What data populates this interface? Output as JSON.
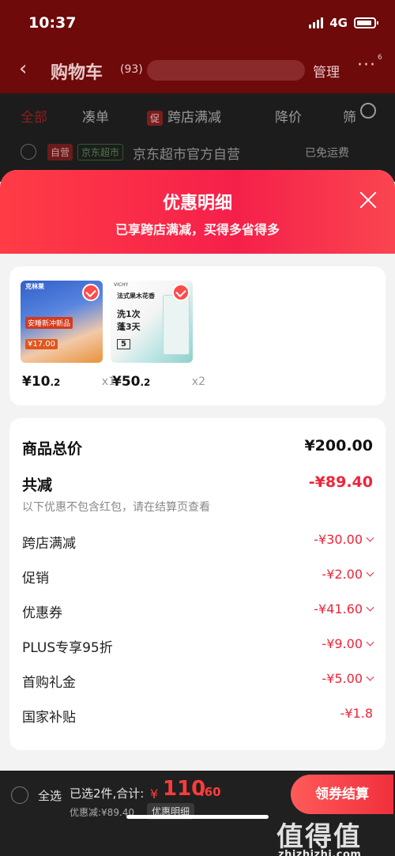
{
  "status_bar": {
    "time": "10:37",
    "network": "4G"
  },
  "cart_header": {
    "title": "购物车",
    "count": "(93)",
    "address_hint": "<",
    "manage": "管理",
    "message_badge": "6"
  },
  "filter_tabs": [
    "全部",
    "凑单",
    "促",
    "跨店满减",
    "降价",
    "筛"
  ],
  "store": {
    "tag_ziying": "自营",
    "tag_market": "京东超市",
    "name": "京东超市官方自营",
    "shipping": "已免运费"
  },
  "sheet": {
    "title": "优惠明细",
    "subtitle": "已享跨店满减，买得多省得多",
    "products": [
      {
        "price_int": "¥10",
        "price_dec": ".2",
        "qty": "x1",
        "image_texts": [
          "克林莱",
          "安睡新冲新品",
          "¥17.00"
        ]
      },
      {
        "price_int": "¥50",
        "price_dec": ".2",
        "qty": "x2",
        "image_texts": [
          "VICHY",
          "法式果木花香",
          "洗1次",
          "蓬3天",
          "5"
        ]
      }
    ],
    "summary": {
      "total_label": "商品总价",
      "total_value": "¥200.00",
      "reduce_label": "共减",
      "reduce_value": "-¥89.40",
      "note": "以下优惠不包含红包，请在结算页查看",
      "items": [
        {
          "label": "跨店满减",
          "value": "-¥30.00",
          "expandable": true
        },
        {
          "label": "促销",
          "value": "-¥2.00",
          "expandable": true
        },
        {
          "label": "优惠券",
          "value": "-¥41.60",
          "expandable": true
        },
        {
          "label": "PLUS专享95折",
          "value": "-¥9.00",
          "expandable": true
        },
        {
          "label": "首购礼金",
          "value": "-¥5.00",
          "expandable": true
        },
        {
          "label": "国家补贴",
          "value": "-¥1.8",
          "expandable": false
        }
      ]
    }
  },
  "bottom_bar": {
    "select_all": "全选",
    "selected_info": "已选2件,合计:",
    "sum_prefix": "¥",
    "sum_int": "110",
    "sum_dec": ".60",
    "discount_line": "优惠减:¥89.40",
    "discount_detail": "优惠明细",
    "checkout": "领券结算"
  },
  "watermark": {
    "logo": "值得值",
    "url": "zhizhizhi.com"
  },
  "colors": {
    "accent_red": "#f0243a",
    "sheet_header": "#ff3c46",
    "bottom_bar": "#202020"
  }
}
